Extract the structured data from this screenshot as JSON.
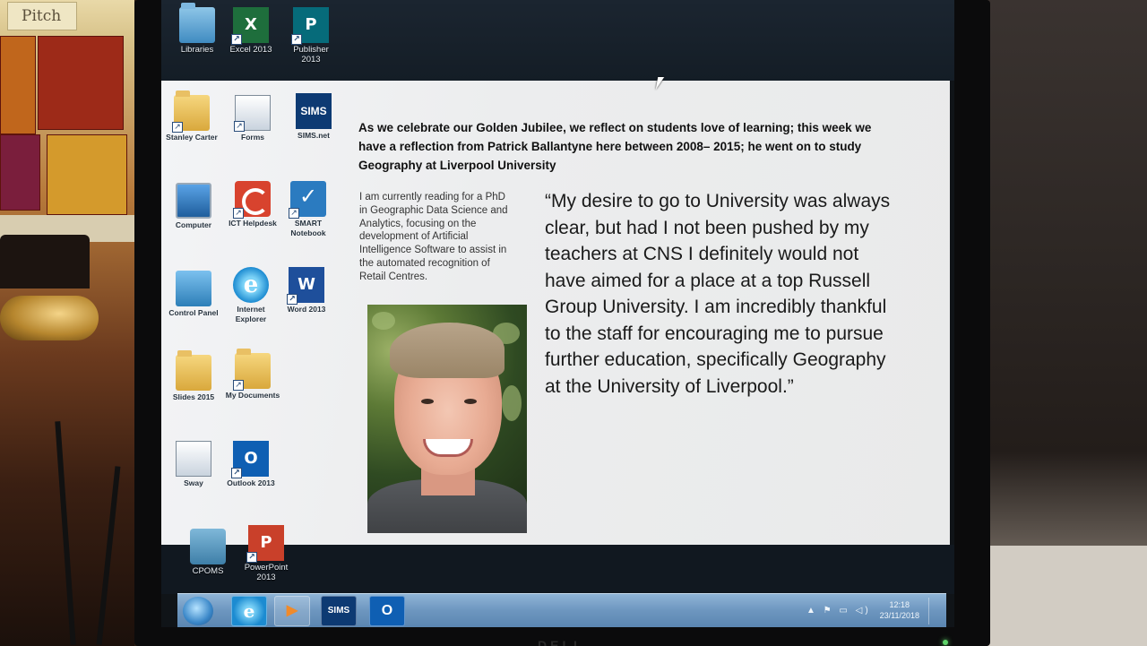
{
  "environment": {
    "sign_text": "Pitch"
  },
  "desktop_top_icons": [
    {
      "id": "libraries",
      "label": "Libraries",
      "icon": "library-folder-icon"
    },
    {
      "id": "excel",
      "label": "Excel 2013",
      "icon": "excel-icon",
      "glyph": "X"
    },
    {
      "id": "publisher",
      "label": "Publisher 2013",
      "icon": "publisher-icon",
      "glyph": "P"
    }
  ],
  "desktop_left_icons": [
    {
      "id": "stanley-carter",
      "label": "Stanley Carter",
      "icon": "user-folder-icon"
    },
    {
      "id": "forms",
      "label": "Forms",
      "icon": "forms-icon"
    },
    {
      "id": "sims-net",
      "label": "SIMS.net",
      "icon": "sims-icon",
      "glyph": "SIMS"
    },
    {
      "id": "computer",
      "label": "Computer",
      "icon": "computer-icon"
    },
    {
      "id": "ict-helpdesk",
      "label": "ICT Helpdesk",
      "icon": "helpdesk-icon"
    },
    {
      "id": "smart-notebook",
      "label": "SMART Notebook",
      "icon": "notebook-icon"
    },
    {
      "id": "control-panel",
      "label": "Control Panel",
      "icon": "control-panel-icon"
    },
    {
      "id": "internet-explorer",
      "label": "Internet Explorer",
      "icon": "internet-explorer-icon",
      "glyph": "e"
    },
    {
      "id": "word",
      "label": "Word 2013",
      "icon": "word-icon",
      "glyph": "W"
    },
    {
      "id": "folder-2",
      "label": "Slides 2015",
      "icon": "folder-icon"
    },
    {
      "id": "my-documents",
      "label": "My Documents",
      "icon": "documents-folder-icon"
    },
    {
      "id": "folder-3",
      "label": "Sway",
      "icon": "document-stack-icon"
    },
    {
      "id": "outlook",
      "label": "Outlook 2013",
      "icon": "outlook-icon",
      "glyph": "O"
    },
    {
      "id": "cpoms",
      "label": "CPOMS",
      "icon": "cpoms-icon"
    },
    {
      "id": "powerpoint",
      "label": "PowerPoint 2013",
      "icon": "powerpoint-icon",
      "glyph": "P"
    }
  ],
  "slide": {
    "headline": "As we celebrate our Golden Jubilee, we reflect on students love of learning; this week we have a reflection from Patrick Ballantyne here between 2008– 2015; he went on to study Geography at Liverpool University",
    "bio": "I am currently reading for a PhD in Geographic Data Science and Analytics, focusing on the development of Artificial Intelligence Software to assist in the automated recognition of Retail Centres.",
    "quote": "“My desire to go to University was always clear, but had I not been pushed by my teachers at CNS I definitely would not have aimed for a place at a top Russell Group University. I am incredibly thankful to the staff for encouraging me to pursue further education, specifically Geography at the University of Liverpool.”"
  },
  "taskbar": {
    "pinned": [
      {
        "id": "internet-explorer",
        "icon": "internet-explorer-icon",
        "glyph": "e"
      },
      {
        "id": "media-player",
        "icon": "media-player-icon",
        "glyph": "▶"
      },
      {
        "id": "sims",
        "icon": "sims-icon",
        "glyph": "SIMS"
      },
      {
        "id": "outlook",
        "icon": "outlook-icon",
        "glyph": "O"
      }
    ],
    "tray_icons": "▲ ⚑ ▭ ◁)",
    "time": "12:18",
    "date": "23/11/2018"
  },
  "monitor_brand": "DELL",
  "colors": {
    "taskbar": "#6d96bf",
    "sims_brand": "#0d3a73",
    "slide_background": "#ecedee"
  }
}
